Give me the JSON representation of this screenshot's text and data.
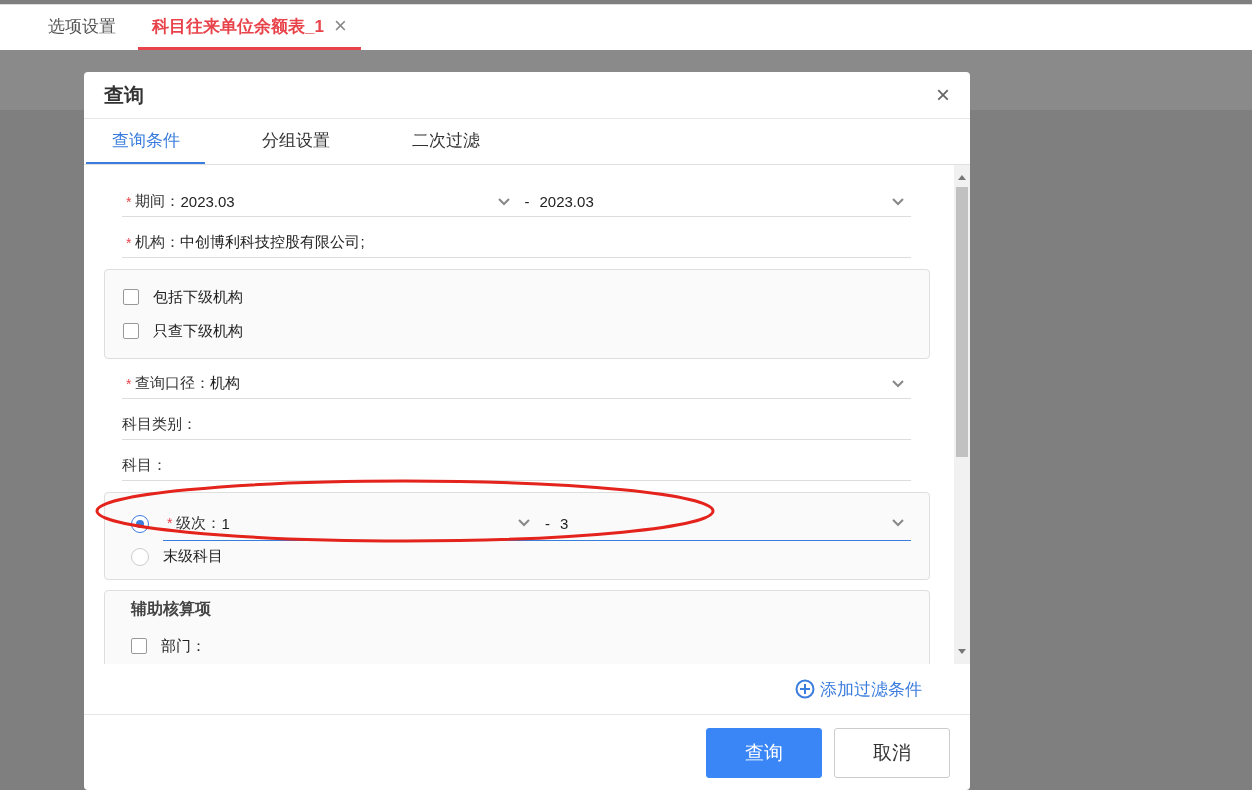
{
  "tabs": [
    {
      "label": "选项设置",
      "selected": false
    },
    {
      "label": "科目往来单位余额表_1",
      "selected": true,
      "close": "×"
    }
  ],
  "dialog": {
    "title": "查询",
    "close": "×",
    "tabs": [
      {
        "label": "查询条件",
        "selected": true
      },
      {
        "label": "分组设置",
        "selected": false
      },
      {
        "label": "二次过滤",
        "selected": false
      }
    ],
    "fields": [
      {
        "kind": "range",
        "required": "*",
        "label": "期间：",
        "from": "2023.03",
        "separator": "-",
        "to": "2023.03"
      },
      {
        "kind": "text",
        "required": "*",
        "label": "机构：",
        "value": "中创博利科技控股有限公司;"
      },
      {
        "kind": "checkbox-group",
        "items": [
          {
            "label": "包括下级机构",
            "checked": false
          },
          {
            "label": "只查下级机构",
            "checked": false
          }
        ]
      },
      {
        "kind": "select",
        "required": "*",
        "label": "查询口径：",
        "value": "机构"
      },
      {
        "kind": "text",
        "label": "科目类别："
      },
      {
        "kind": "text",
        "label": "科目："
      },
      {
        "kind": "radio-group",
        "items": [
          {
            "kind": "range",
            "selected": true,
            "required": "*",
            "label": "级次：",
            "from": "1",
            "separator": "-",
            "to": "3"
          },
          {
            "kind": "plain",
            "selected": false,
            "label": "末级科目"
          }
        ]
      },
      {
        "kind": "section",
        "title": "辅助核算项",
        "items": [
          {
            "label": "部门：",
            "checked": false
          }
        ]
      }
    ],
    "add_filter": "添加过滤条件",
    "buttons": [
      {
        "label": "查询",
        "kind": "primary"
      },
      {
        "label": "取消",
        "kind": "default"
      }
    ]
  }
}
